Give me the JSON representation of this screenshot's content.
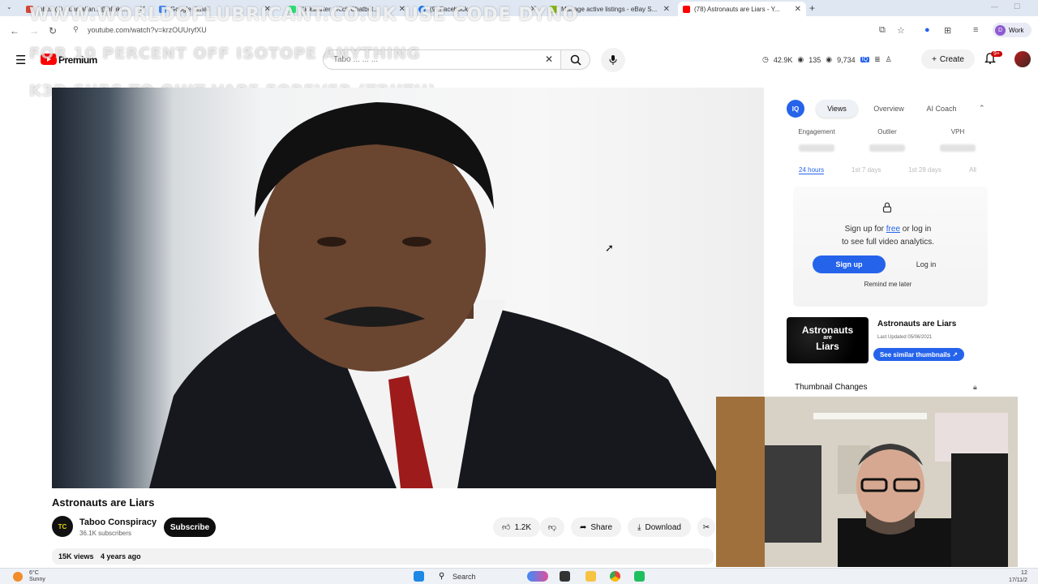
{
  "browser": {
    "tabs": [
      {
        "label": "Inbox (4) - dan.allan...@blinkr..."
      },
      {
        "label": "Google Gmail"
      },
      {
        "label": "Kickstarter - Kick Chatbot..."
      },
      {
        "label": "(9) Facebook"
      },
      {
        "label": "Manage active listings - eBay S..."
      },
      {
        "label": "(78) Astronauts are Liars - Y..."
      }
    ],
    "url": "youtube.com/watch?v=krzOUUryfXU",
    "profile": "Work",
    "profile_initial": "D"
  },
  "overlay": {
    "line1": "WWW.WORLDOFLUBRICANT.CO.UK USE CODE DYNO",
    "line2": "FOR 10 PERCENT OFF ISOTOPE ANYTHING",
    "line3": "K3D SUBS TO QUIT VAPE FOREVER (TRUTH)"
  },
  "youtube": {
    "brand": "Premium",
    "search_value": "Tabo ... ... ...",
    "stats": {
      "views": "42.9K",
      "videos": "135",
      "watch": "9,734"
    },
    "create_label": "Create",
    "notifications": "9+"
  },
  "video": {
    "title": "Astronauts are Liars",
    "channel": "Taboo Conspiracy",
    "channel_initials": "TC",
    "subscribers": "36.1K subscribers",
    "subscribe_label": "Subscribe",
    "likes": "1.2K",
    "share_label": "Share",
    "download_label": "Download",
    "views": "15K views",
    "age": "4 years ago"
  },
  "panel": {
    "logo": "IQ",
    "tabs": [
      "Views",
      "Overview",
      "AI Coach"
    ],
    "metrics": [
      "Engagement",
      "Outlier",
      "VPH"
    ],
    "ranges": [
      "24 hours",
      "1st 7 days",
      "1st 28 days",
      "All"
    ],
    "signup_msg_pre": "Sign up for ",
    "signup_msg_link": "free",
    "signup_msg_post": " or log in",
    "signup_msg_line2": "to see full video analytics.",
    "signup_label": "Sign up",
    "login_label": "Log in",
    "remind_label": "Remind me later",
    "thumb_line1": "Astronauts",
    "thumb_line2": "are",
    "thumb_line3": "Liars",
    "thumb_title": "Astronauts are Liars",
    "thumb_updated": "Last Updated 05/06/2021",
    "similar_label": "See similar thumbnails ↗",
    "changes_label": "Thumbnail Changes"
  },
  "taskbar": {
    "temp": "6°C",
    "weather": "Sunny",
    "search_label": "Search",
    "time": "12",
    "date": "17/11/2"
  },
  "colors": {
    "yt_red": "#ff0000",
    "accent_blue": "#2563eb"
  }
}
